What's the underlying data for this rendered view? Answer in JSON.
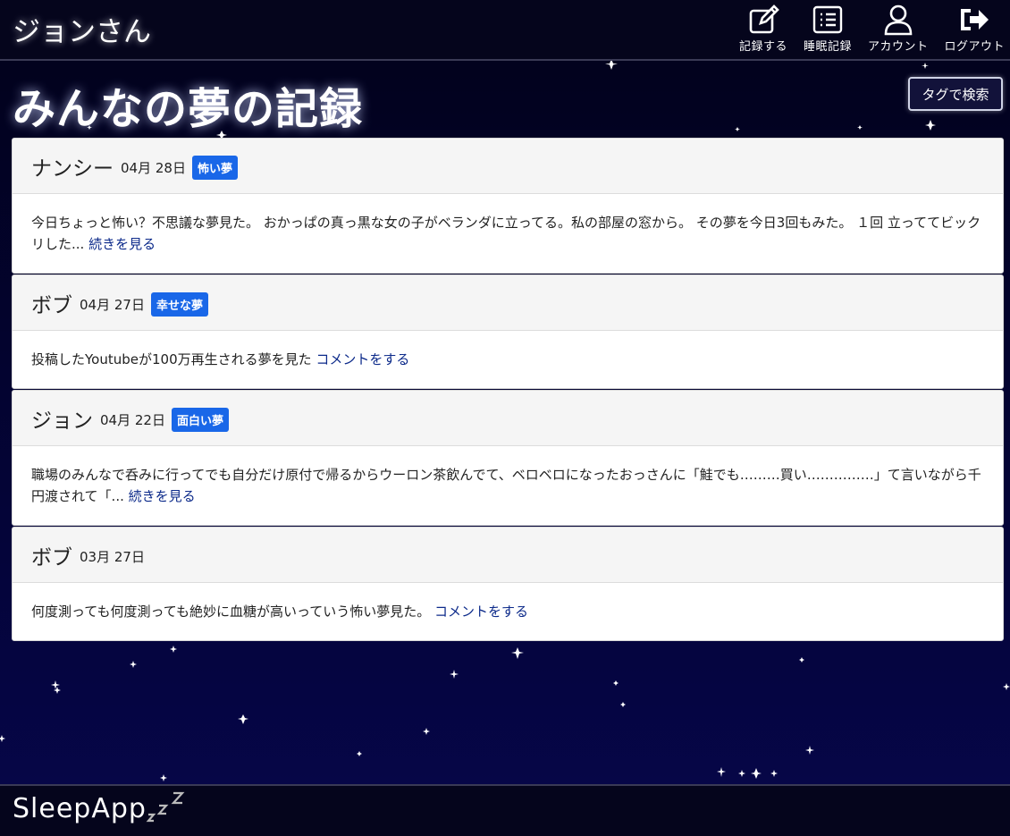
{
  "header": {
    "username": "ジョンさん",
    "nav": [
      {
        "label": "記録する",
        "icon": "edit-icon"
      },
      {
        "label": "睡眠記録",
        "icon": "list-icon"
      },
      {
        "label": "アカウント",
        "icon": "user-icon"
      },
      {
        "label": "ログアウト",
        "icon": "logout-icon"
      }
    ]
  },
  "main": {
    "title": "みんなの夢の記録",
    "tag_search_label": "タグで検索",
    "posts": [
      {
        "author": "ナンシー",
        "date": "04月 28日",
        "tag": "怖い夢",
        "body": "今日ちょっと怖い？不思議な夢見た。 おかっぱの真っ黒な女の子がベランダに立ってる。私の部屋の窓から。 その夢を今日3回もみた。 １回 立っててビックリした...",
        "link": "続きを見る"
      },
      {
        "author": "ボブ",
        "date": "04月 27日",
        "tag": "幸せな夢",
        "body": "投稿したYoutubeが100万再生される夢を見た",
        "link": "コメントをする"
      },
      {
        "author": "ジョン",
        "date": "04月 22日",
        "tag": "面白い夢",
        "body": "職場のみんなで呑みに行ってでも自分だけ原付で帰るからウーロン茶飲んでて、ベロベロになったおっさんに「鮭でも………買い……………」て言いながら千円渡されて「...",
        "link": "続きを見る"
      },
      {
        "author": "ボブ",
        "date": "03月 27日",
        "tag": "",
        "body": "何度測っても何度測っても絶妙に血糖が高いっていう怖い夢見た。",
        "link": "コメントをする"
      }
    ]
  },
  "footer": {
    "brand": "SleepApp",
    "brand_icon": "zzz-icon"
  },
  "colors": {
    "tag_bg": "#1967e8",
    "link": "#0c2a8a",
    "header_bg": "#05051c"
  }
}
